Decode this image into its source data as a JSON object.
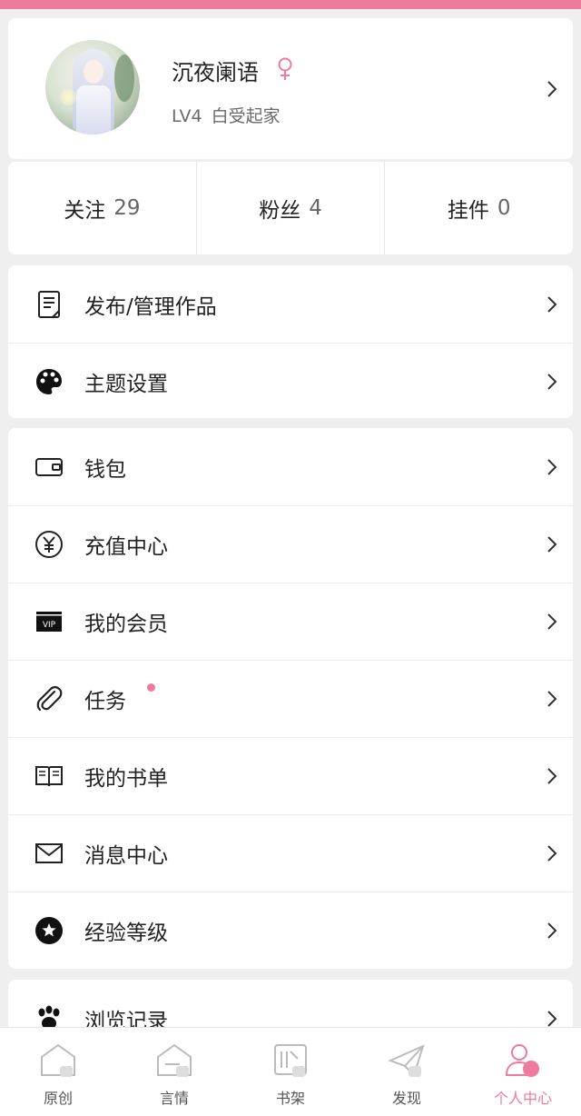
{
  "profile": {
    "username": "沉夜阑语",
    "gender_icon": "female-icon",
    "level": "LV4",
    "title": "白受起家"
  },
  "stats": [
    {
      "label": "关注",
      "count": "29"
    },
    {
      "label": "粉丝",
      "count": "4"
    },
    {
      "label": "挂件",
      "count": "0"
    }
  ],
  "menu_group_1": [
    {
      "label": "发布/管理作品",
      "icon": "document-icon"
    },
    {
      "label": "主题设置",
      "icon": "palette-icon"
    }
  ],
  "menu_group_2": [
    {
      "label": "钱包",
      "icon": "wallet-icon"
    },
    {
      "label": "充值中心",
      "icon": "yen-icon"
    },
    {
      "label": "我的会员",
      "icon": "vip-icon"
    },
    {
      "label": "任务",
      "icon": "paperclip-icon",
      "has_dot": true
    },
    {
      "label": "我的书单",
      "icon": "book-icon"
    },
    {
      "label": "消息中心",
      "icon": "mail-icon"
    },
    {
      "label": "经验等级",
      "icon": "star-badge-icon"
    }
  ],
  "menu_group_3": [
    {
      "label": "浏览记录",
      "icon": "paw-icon"
    }
  ],
  "tabbar": [
    {
      "label": "原创",
      "icon": "home-icon",
      "active": false
    },
    {
      "label": "言情",
      "icon": "heart-home-icon",
      "active": false
    },
    {
      "label": "书架",
      "icon": "bookshelf-icon",
      "active": false
    },
    {
      "label": "发现",
      "icon": "paper-plane-icon",
      "active": false
    },
    {
      "label": "个人中心",
      "icon": "user-icon",
      "active": true
    }
  ],
  "colors": {
    "accent": "#f07a9d",
    "background": "#efefef"
  }
}
